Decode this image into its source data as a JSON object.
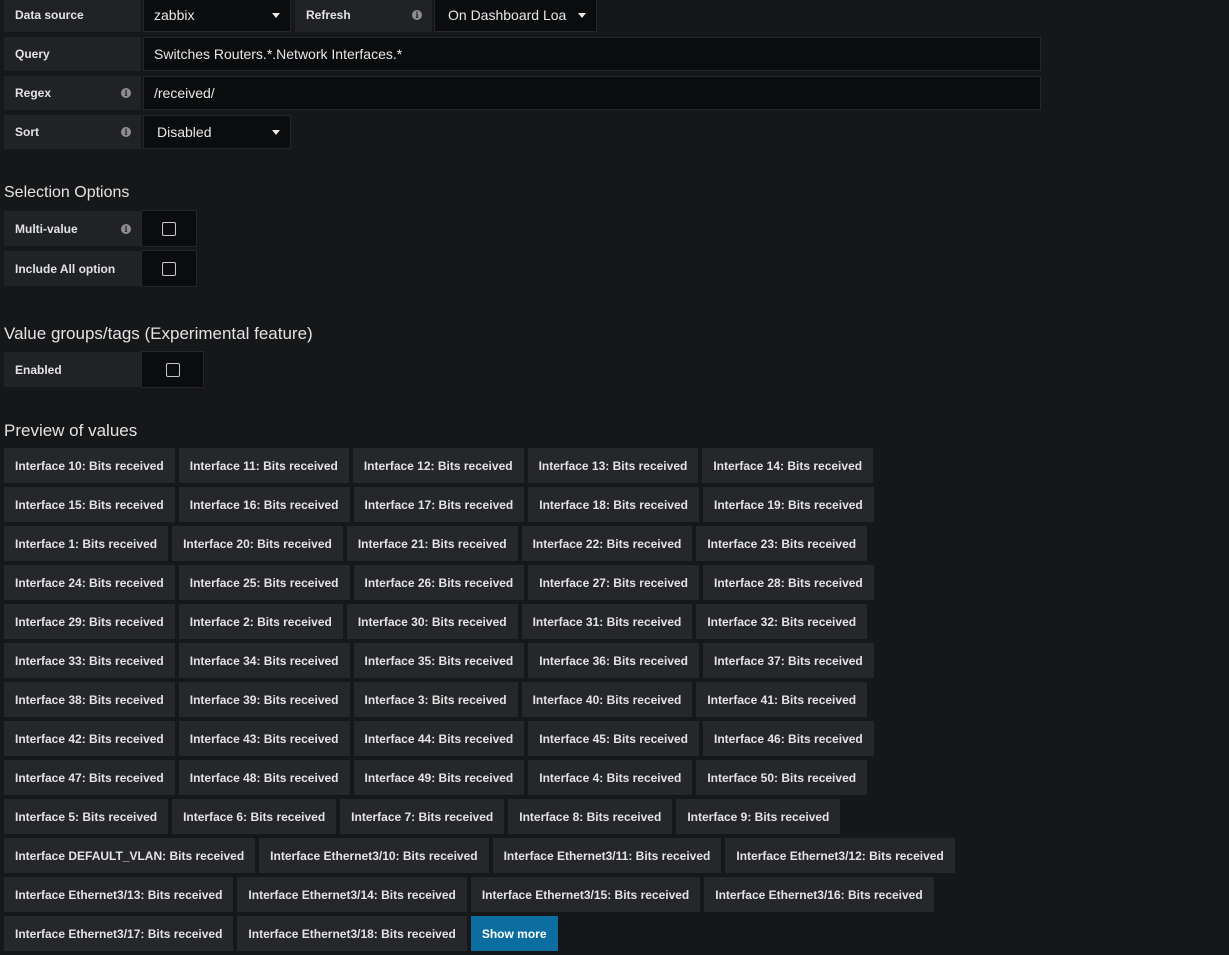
{
  "query_options": {
    "datasource_label": "Data source",
    "datasource_value": "zabbix",
    "refresh_label": "Refresh",
    "refresh_value": "On Dashboard Loa",
    "query_label": "Query",
    "query_value": "Switches Routers.*.Network Interfaces.*",
    "regex_label": "Regex",
    "regex_value": "/received/",
    "sort_label": "Sort",
    "sort_value": "Disabled"
  },
  "selection_options": {
    "title": "Selection Options",
    "multi_value_label": "Multi-value",
    "include_all_label": "Include All option"
  },
  "value_groups": {
    "title": "Value groups/tags (Experimental feature)",
    "enabled_label": "Enabled"
  },
  "preview": {
    "title": "Preview of values",
    "values": [
      "Interface 10: Bits received",
      "Interface 11: Bits received",
      "Interface 12: Bits received",
      "Interface 13: Bits received",
      "Interface 14: Bits received",
      "Interface 15: Bits received",
      "Interface 16: Bits received",
      "Interface 17: Bits received",
      "Interface 18: Bits received",
      "Interface 19: Bits received",
      "Interface 1: Bits received",
      "Interface 20: Bits received",
      "Interface 21: Bits received",
      "Interface 22: Bits received",
      "Interface 23: Bits received",
      "Interface 24: Bits received",
      "Interface 25: Bits received",
      "Interface 26: Bits received",
      "Interface 27: Bits received",
      "Interface 28: Bits received",
      "Interface 29: Bits received",
      "Interface 2: Bits received",
      "Interface 30: Bits received",
      "Interface 31: Bits received",
      "Interface 32: Bits received",
      "Interface 33: Bits received",
      "Interface 34: Bits received",
      "Interface 35: Bits received",
      "Interface 36: Bits received",
      "Interface 37: Bits received",
      "Interface 38: Bits received",
      "Interface 39: Bits received",
      "Interface 3: Bits received",
      "Interface 40: Bits received",
      "Interface 41: Bits received",
      "Interface 42: Bits received",
      "Interface 43: Bits received",
      "Interface 44: Bits received",
      "Interface 45: Bits received",
      "Interface 46: Bits received",
      "Interface 47: Bits received",
      "Interface 48: Bits received",
      "Interface 49: Bits received",
      "Interface 4: Bits received",
      "Interface 50: Bits received",
      "Interface 5: Bits received",
      "Interface 6: Bits received",
      "Interface 7: Bits received",
      "Interface 8: Bits received",
      "Interface 9: Bits received",
      "Interface DEFAULT_VLAN: Bits received",
      "Interface Ethernet3/10: Bits received",
      "Interface Ethernet3/11: Bits received",
      "Interface Ethernet3/12: Bits received",
      "Interface Ethernet3/13: Bits received",
      "Interface Ethernet3/14: Bits received",
      "Interface Ethernet3/15: Bits received",
      "Interface Ethernet3/16: Bits received",
      "Interface Ethernet3/17: Bits received",
      "Interface Ethernet3/18: Bits received"
    ],
    "show_more_label": "Show more"
  },
  "colors": {
    "background": "#161719",
    "label_bg": "#202226",
    "input_bg": "#0b0c0e",
    "chip_bg": "#26272b",
    "primary_button": "#0b6da0"
  }
}
